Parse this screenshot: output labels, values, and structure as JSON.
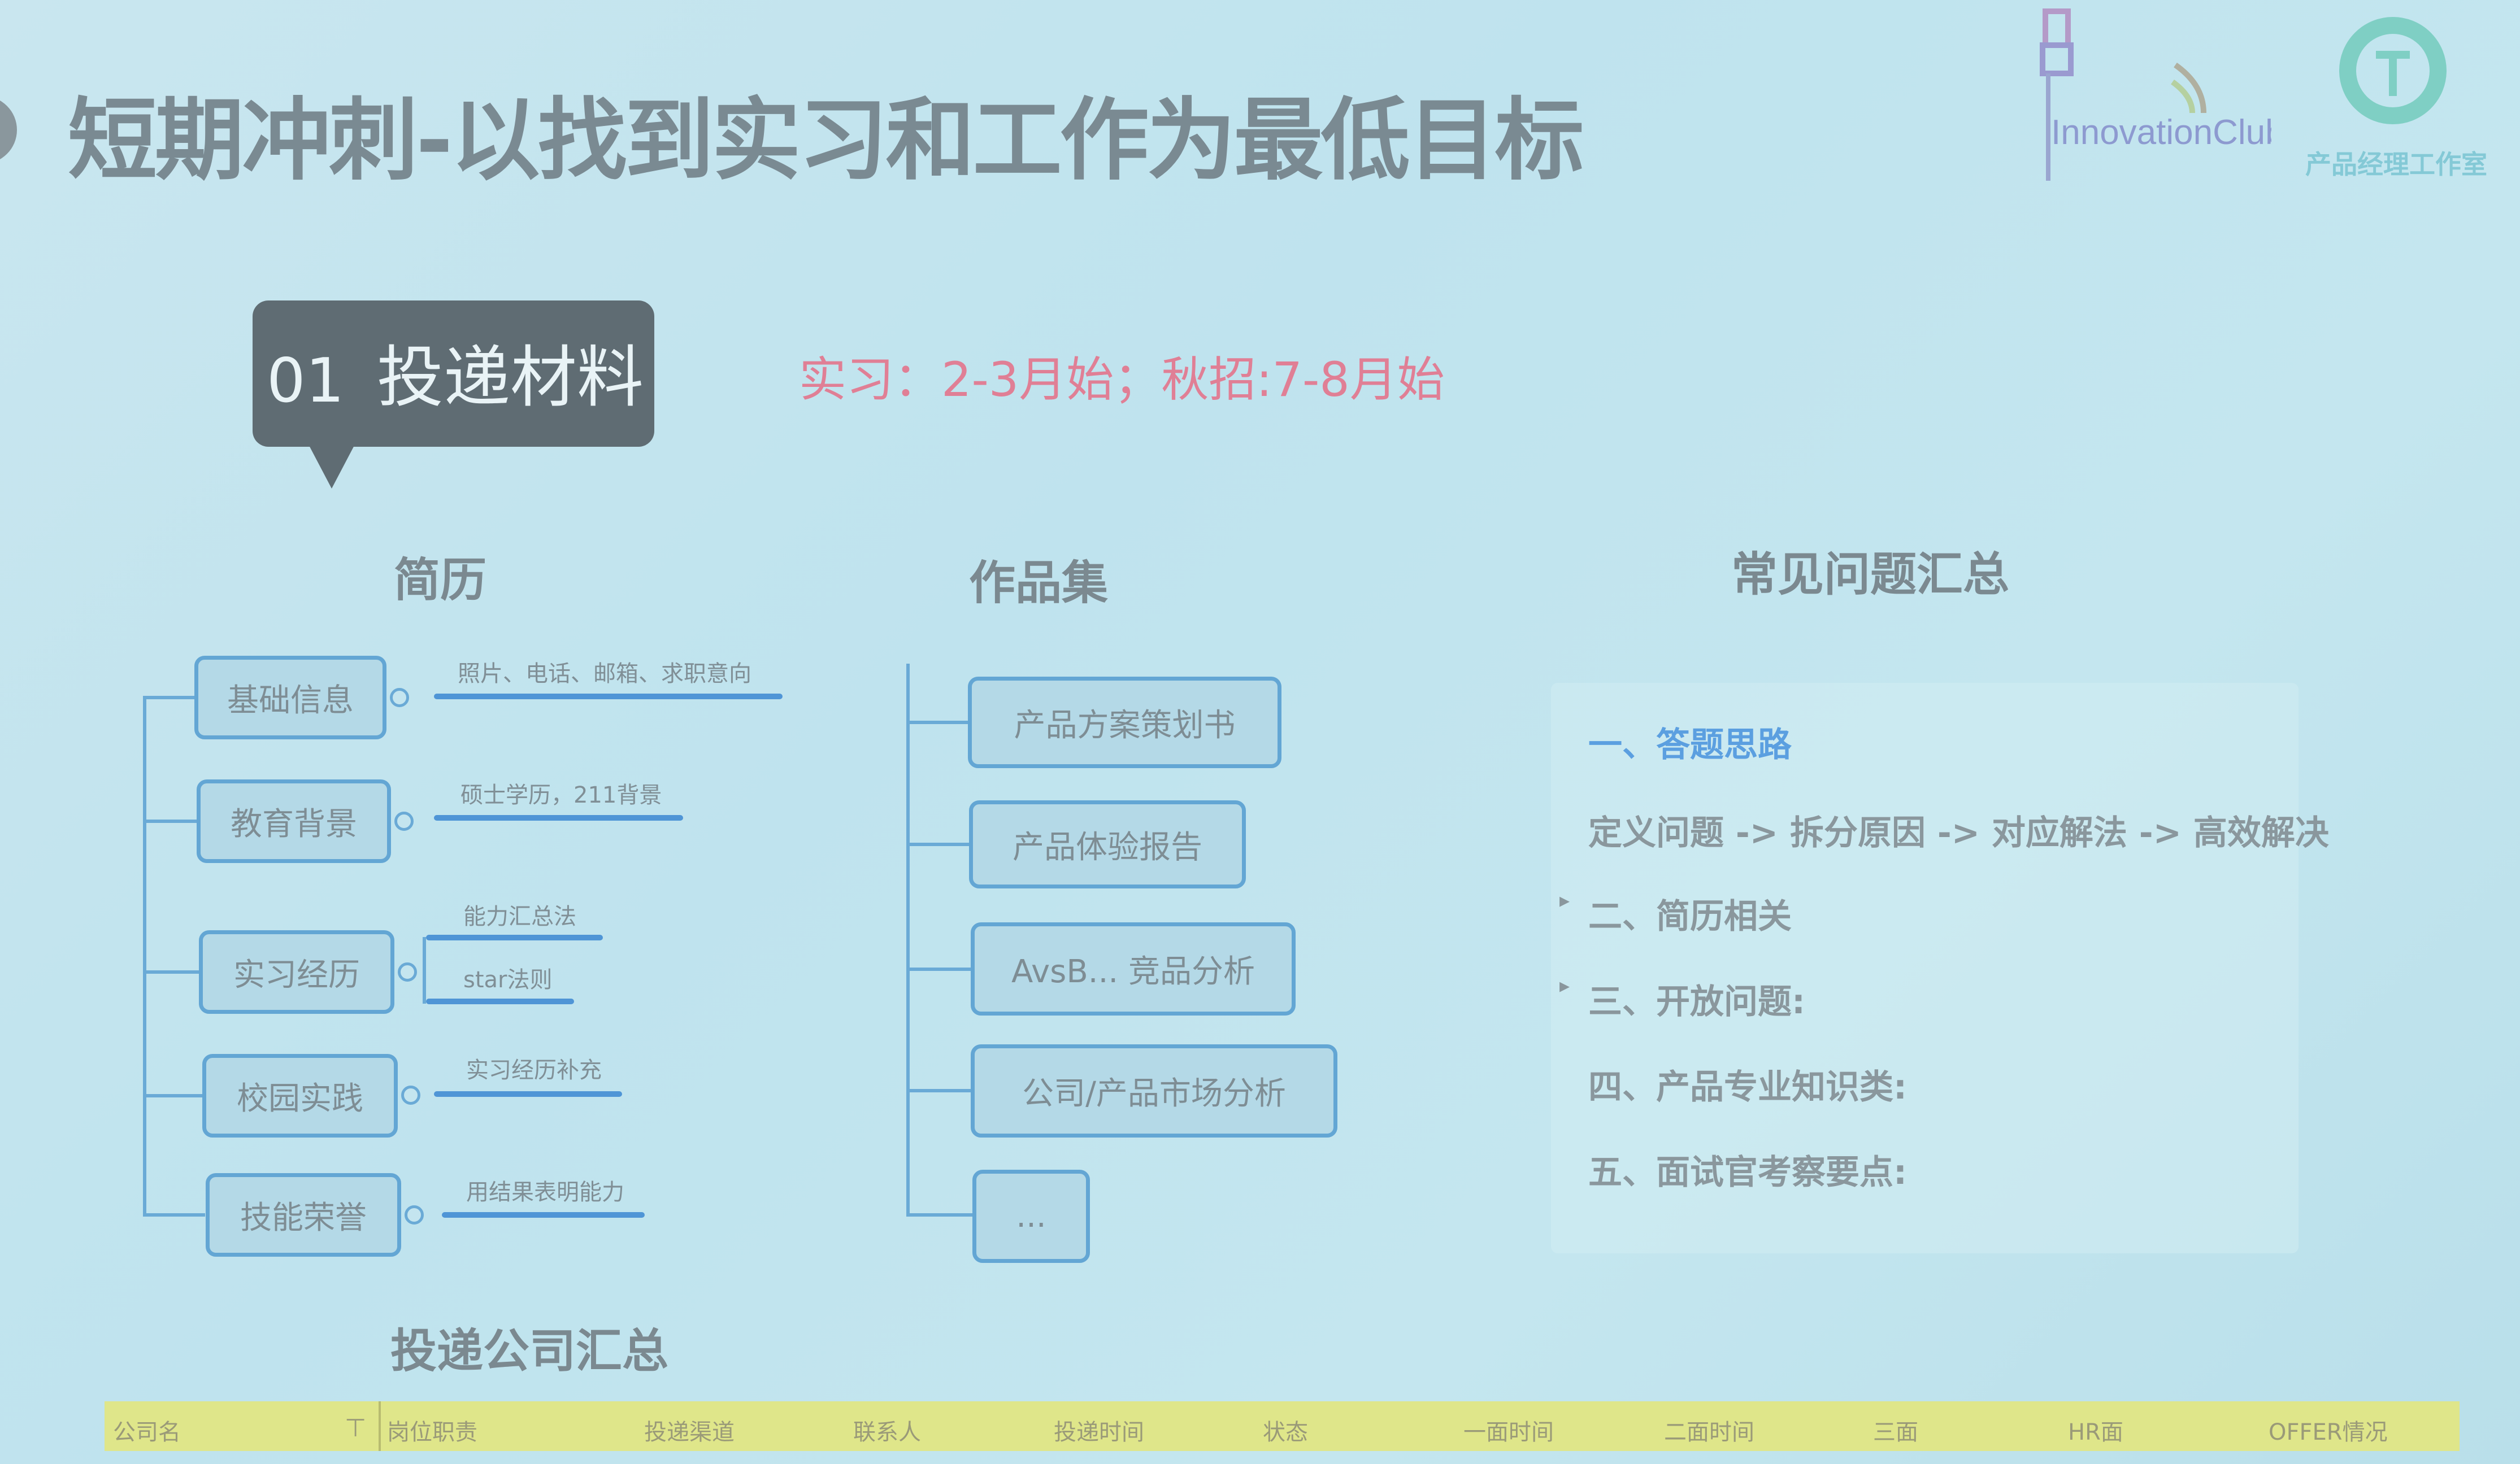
{
  "title": "短期冲刺-以找到实习和工作为最低目标",
  "logos": {
    "left": "InnovationClub",
    "right": "产品经理工作室"
  },
  "section": {
    "number": "01",
    "label": "投递材料"
  },
  "timeline": "实习：2-3月始；秋招:7-8月始",
  "resume": {
    "heading": "简历",
    "items": [
      {
        "label": "基础信息",
        "notes": [
          "照片、电话、邮箱、求职意向"
        ]
      },
      {
        "label": "教育背景",
        "notes": [
          "硕士学历，211背景"
        ]
      },
      {
        "label": "实习经历",
        "notes": [
          "能力汇总法",
          "star法则"
        ]
      },
      {
        "label": "校园实践",
        "notes": [
          "实习经历补充"
        ]
      },
      {
        "label": "技能荣誉",
        "notes": [
          "用结果表明能力"
        ]
      }
    ]
  },
  "portfolio": {
    "heading": "作品集",
    "items": [
      "产品方案策划书",
      "产品体验报告",
      "AvsB... 竞品分析",
      "公司/产品市场分析",
      "..."
    ]
  },
  "faq": {
    "heading": "常见问题汇总",
    "items": [
      "一、答题思路",
      "定义问题 -> 拆分原因 -> 对应解法 -> 高效解决",
      "二、简历相关",
      "三、开放问题:",
      "四、产品专业知识类:",
      "五、面试官考察要点:"
    ],
    "highlight_color": "#5b9fe0"
  },
  "companies": {
    "heading": "投递公司汇总",
    "columns": [
      "公司名",
      "岗位职责",
      "投递渠道",
      "联系人",
      "投递时间",
      "状态",
      "一面时间",
      "二面时间",
      "三面",
      "HR面",
      "OFFER情况"
    ],
    "header_color": "#dfe68a"
  },
  "colors": {
    "background": "#bfe3ee",
    "accent_pink": "#e07f95",
    "node_border": "#63a6d4",
    "bubble": "#5f6c73"
  }
}
